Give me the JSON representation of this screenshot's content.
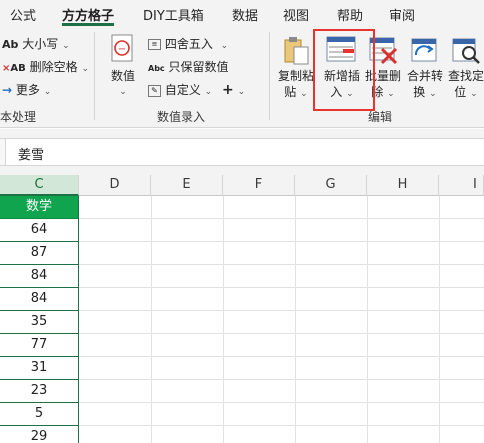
{
  "tabs": [
    {
      "label": "公式"
    },
    {
      "label": "方方格子"
    },
    {
      "label": "DIY工具箱"
    },
    {
      "label": "数据"
    },
    {
      "label": "视图"
    },
    {
      "label": "帮助"
    },
    {
      "label": "审阅"
    }
  ],
  "ribbon": {
    "text_group": {
      "case_label": "大小写",
      "remove_spaces_label": "删除空格",
      "more_label": "更多",
      "group_label": "本处理"
    },
    "number_group": {
      "value_label": "数值",
      "round_label": "四舍五入",
      "keep_value_label": "只保留数值",
      "custom_label": "自定义",
      "group_label": "数值录入"
    },
    "edit_group": {
      "copy_paste_line1": "复制粘",
      "copy_paste_line2": "贴",
      "insert_line1": "新增插",
      "insert_line2": "入",
      "batch_delete_line1": "批量删",
      "batch_delete_line2": "除",
      "merge_line1": "合并转",
      "merge_line2": "换",
      "find_line1": "查找定",
      "find_line2": "位",
      "group_label": "编辑"
    }
  },
  "formula_bar": {
    "value": "姜雪"
  },
  "columns": [
    "C",
    "D",
    "E",
    "F",
    "G",
    "H",
    "I"
  ],
  "column_c": {
    "header": "数学",
    "values": [
      "64",
      "87",
      "84",
      "84",
      "35",
      "77",
      "31",
      "23",
      "5",
      "29"
    ]
  },
  "colors": {
    "accent": "#1e7145",
    "header_fill": "#11a44f",
    "highlight_box": "#e8332f"
  }
}
